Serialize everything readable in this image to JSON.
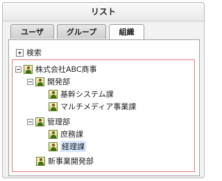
{
  "panel": {
    "title": "リスト"
  },
  "tabs": [
    {
      "label": "ユーザ",
      "active": false
    },
    {
      "label": "グループ",
      "active": false
    },
    {
      "label": "組織",
      "active": true
    }
  ],
  "search": {
    "label": "検索"
  },
  "tree": {
    "root": {
      "label": "株式会社ABC商事",
      "expanded": true
    },
    "dept1": {
      "label": "開発部",
      "expanded": true
    },
    "dept1_a": {
      "label": "基幹システム課"
    },
    "dept1_b": {
      "label": "マルチメディア事業課"
    },
    "dept2": {
      "label": "管理部",
      "expanded": true
    },
    "dept2_a": {
      "label": "庶務課"
    },
    "dept2_b": {
      "label": "経理課",
      "selected": true
    },
    "dept3": {
      "label": "新事業開発部"
    }
  }
}
